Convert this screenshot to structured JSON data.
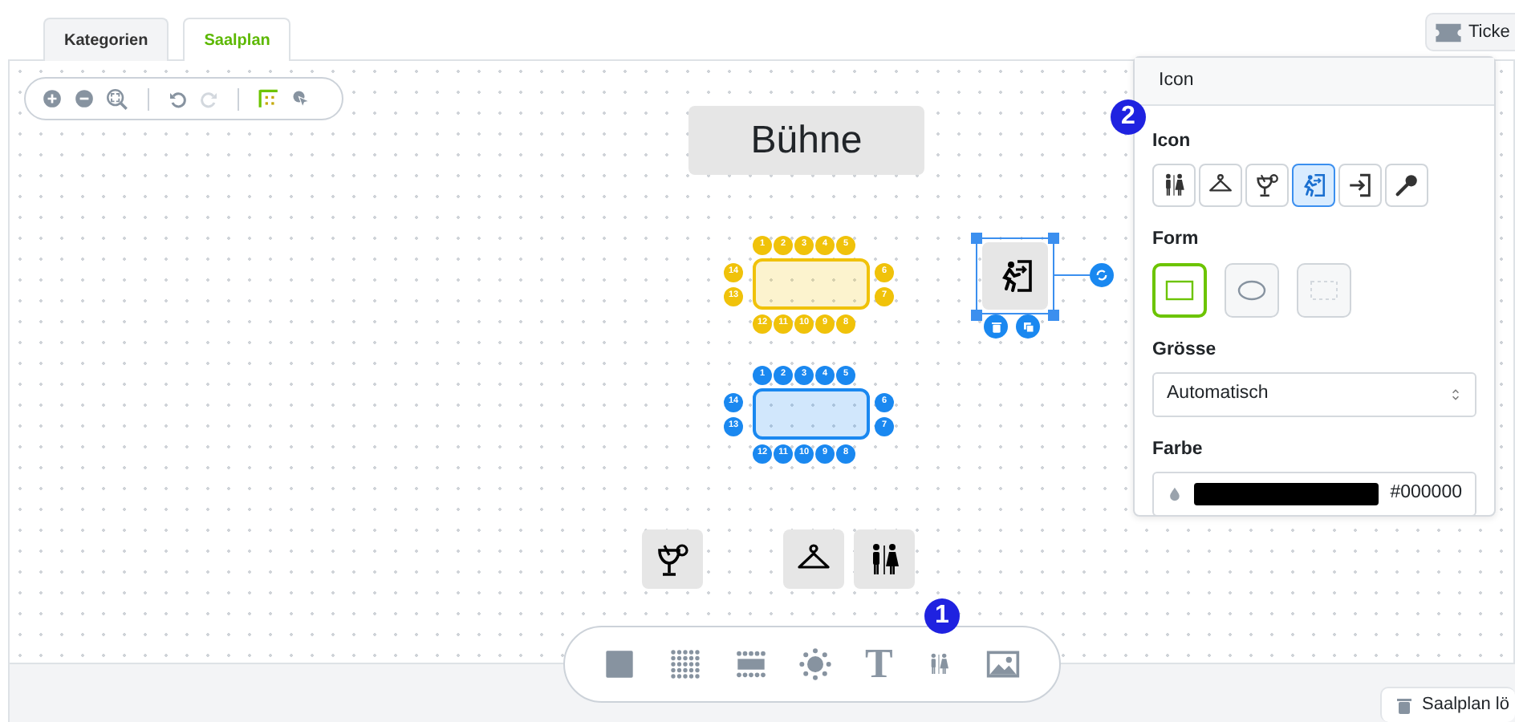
{
  "tabs": [
    {
      "label": "Kategorien",
      "selected": false
    },
    {
      "label": "Saalplan",
      "selected": true
    }
  ],
  "ticket_button": {
    "label": "Ticke"
  },
  "toolbar": [
    {
      "kind": "zoom-in",
      "disabled": false
    },
    {
      "kind": "zoom-out",
      "disabled": false
    },
    {
      "kind": "zoom-fit",
      "disabled": false
    },
    {
      "kind": "divider"
    },
    {
      "kind": "undo",
      "disabled": false
    },
    {
      "kind": "redo",
      "disabled": true
    },
    {
      "kind": "divider"
    },
    {
      "kind": "grid",
      "disabled": false
    },
    {
      "kind": "snap",
      "disabled": false
    }
  ],
  "stage": {
    "label": "Bühne"
  },
  "tables": [
    {
      "color": "#f0c20a",
      "seats": [
        "1",
        "2",
        "3",
        "4",
        "5",
        "14",
        "6",
        "13",
        "7",
        "12",
        "11",
        "10",
        "9",
        "8"
      ]
    },
    {
      "color": "#1a88f0",
      "seats": [
        "1",
        "2",
        "3",
        "4",
        "5",
        "14",
        "6",
        "13",
        "7",
        "12",
        "11",
        "10",
        "9",
        "8"
      ]
    }
  ],
  "canvas_icons": [
    {
      "kind": "exit",
      "selected": true
    },
    {
      "kind": "cocktail",
      "selected": false
    },
    {
      "kind": "hanger",
      "selected": false
    },
    {
      "kind": "toilets",
      "selected": false
    }
  ],
  "palette": [
    {
      "kind": "square"
    },
    {
      "kind": "seat-grid"
    },
    {
      "kind": "seat-rows"
    },
    {
      "kind": "round-table"
    },
    {
      "kind": "text",
      "label": "T"
    },
    {
      "kind": "toilets"
    },
    {
      "kind": "image"
    }
  ],
  "callouts": [
    {
      "label": "1"
    },
    {
      "label": "2"
    }
  ],
  "panel": {
    "title": "Icon",
    "icon_label": "Icon",
    "icon_options": [
      {
        "kind": "toilets",
        "selected": false
      },
      {
        "kind": "hanger",
        "selected": false
      },
      {
        "kind": "cocktail",
        "selected": false
      },
      {
        "kind": "exit",
        "selected": true
      },
      {
        "kind": "entrance",
        "selected": false
      },
      {
        "kind": "microphone",
        "selected": false
      }
    ],
    "form_label": "Form",
    "form_options": [
      {
        "kind": "rectangle",
        "selected": true
      },
      {
        "kind": "ellipse",
        "selected": false
      },
      {
        "kind": "none",
        "selected": false
      }
    ],
    "size_label": "Grösse",
    "size_value": "Automatisch",
    "color_label": "Farbe",
    "color": "#000000",
    "color_value": "#000000"
  },
  "delete_button": {
    "label": "Saalplan lö"
  }
}
